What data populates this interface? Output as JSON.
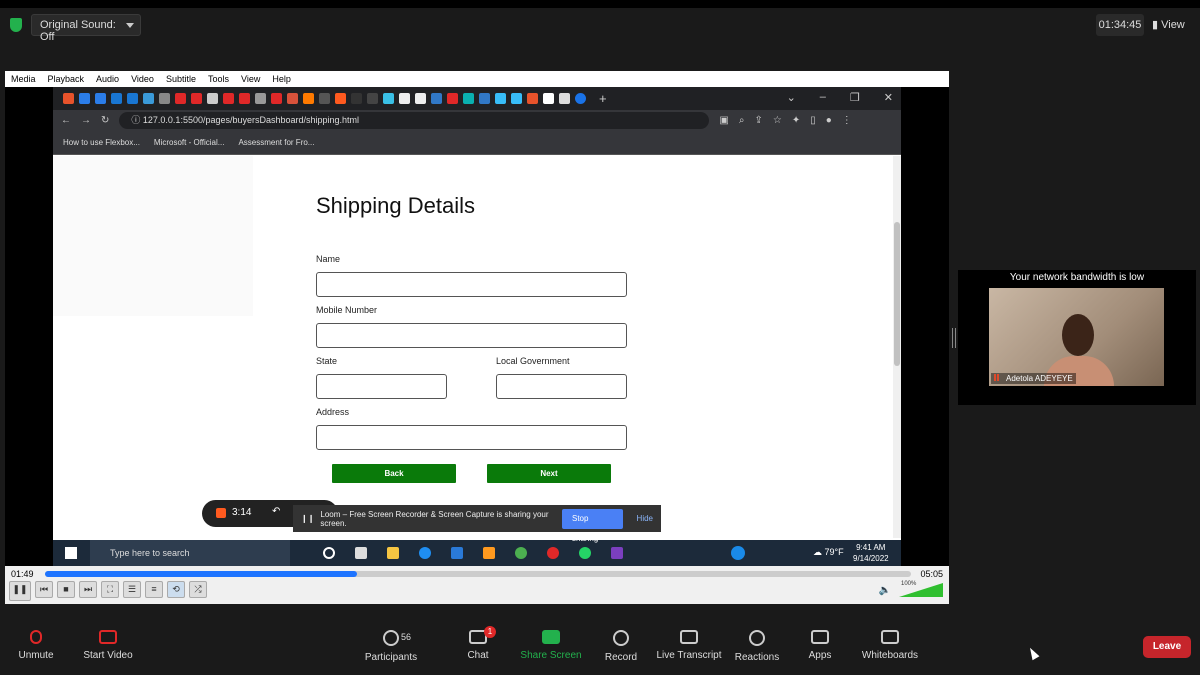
{
  "zoom_top": {
    "sound_label": "Original Sound: Off",
    "timer": "01:34:45",
    "view_label": "View"
  },
  "vlc": {
    "menu": [
      "Media",
      "Playback",
      "Audio",
      "Video",
      "Subtitle",
      "Tools",
      "View",
      "Help"
    ],
    "time_elapsed": "01:49",
    "time_total": "05:05",
    "progress": 0.36,
    "volume_label": "100%"
  },
  "browser": {
    "url": "127.0.0.1:5500/pages/buyersDashboard/shipping.html",
    "bookmarks": [
      "How to use Flexbox...",
      "Microsoft - Official...",
      "Assessment for Fro..."
    ]
  },
  "form": {
    "title": "Shipping Details",
    "name_label": "Name",
    "mobile_label": "Mobile Number",
    "state_label": "State",
    "lg_label": "Local Government",
    "address_label": "Address",
    "back_label": "Back",
    "next_label": "Next"
  },
  "loom": {
    "rec_time": "3:14",
    "share_msg": "Loom – Free Screen Recorder & Screen Capture is sharing your screen.",
    "stop_label": "Stop sharing",
    "hide_label": "Hide"
  },
  "taskbar": {
    "search_placeholder": "Type here to search",
    "temp": "79°F",
    "time": "9:41 AM",
    "date": "9/14/2022"
  },
  "participant": {
    "bandwidth_msg": "Your network bandwidth is low",
    "name": "Adetola ADEYEYE"
  },
  "zoom_bottom": {
    "unmute": "Unmute",
    "start_video": "Start Video",
    "participants_label": "Participants",
    "participants_count": "56",
    "chat_label": "Chat",
    "chat_badge": "1",
    "share_label": "Share Screen",
    "record_label": "Record",
    "transcript_label": "Live Transcript",
    "reactions_label": "Reactions",
    "apps_label": "Apps",
    "whiteboards_label": "Whiteboards",
    "leave_label": "Leave"
  },
  "colors": {
    "accent_green": "#0a7a0a",
    "zoom_green": "#23b14d",
    "leave_red": "#c6252b",
    "vlc_blue": "#1e74ff"
  }
}
